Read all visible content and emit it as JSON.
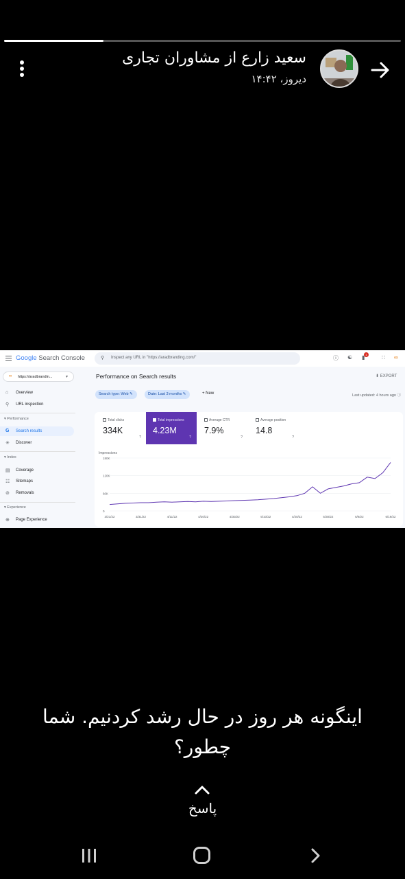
{
  "story": {
    "progress": 0.25
  },
  "header": {
    "title": "سعید زارع از مشاوران تجاری",
    "timestamp": "دیروز، ۱۴:۴۲",
    "back_icon": "arrow-right-icon",
    "menu_icon": "more-vert-icon"
  },
  "screenshot": {
    "logo_google": "Google",
    "logo_product": "Search Console",
    "search_placeholder": "Inspect any URL in \"https://aradbranding.com/\"",
    "property": "https://aradbrandin...",
    "nav": {
      "overview": "Overview",
      "url_inspection": "URL inspection",
      "section_performance": "Performance",
      "search_results": "Search results",
      "discover": "Discover",
      "section_index": "Index",
      "coverage": "Coverage",
      "sitemaps": "Sitemaps",
      "removals": "Removals",
      "section_experience": "Experience",
      "page_experience": "Page Experience"
    },
    "page_title": "Performance on Search results",
    "export": "EXPORT",
    "filter_type": "Search type: Web",
    "filter_date": "Date: Last 3 months",
    "new_label": "New",
    "last_updated": "Last updated: 4 hours ago",
    "notification_count": "1",
    "metrics": [
      {
        "label": "Total clicks",
        "value": "334K",
        "selected": false
      },
      {
        "label": "Total impressions",
        "value": "4.23M",
        "selected": true
      },
      {
        "label": "Average CTR",
        "value": "7.9%",
        "selected": false
      },
      {
        "label": "Average position",
        "value": "14.8",
        "selected": false
      }
    ],
    "accent_color": "#5e35b1"
  },
  "chart_data": {
    "type": "line",
    "ylabel": "Impressions",
    "y_ticks": [
      "180K",
      "120K",
      "60K",
      "0"
    ],
    "ylim": [
      0,
      180000
    ],
    "x_ticks": [
      "3/21/22",
      "3/31/22",
      "4/11/22",
      "4/20/22",
      "4/30/22",
      "5/10/22",
      "4/20/22",
      "5/30/22",
      "6/9/22",
      "6/19/22"
    ],
    "series": [
      {
        "color": "#5e35b1",
        "values": [
          22000,
          24000,
          26000,
          27000,
          28000,
          28000,
          30000,
          31000,
          30000,
          31000,
          32000,
          31000,
          33000,
          32000,
          33000,
          34000,
          35000,
          36000,
          37000,
          38000,
          40000,
          42000,
          45000,
          48000,
          52000,
          60000,
          82000,
          60000,
          75000,
          80000,
          85000,
          92000,
          96000,
          115000,
          110000,
          130000,
          165000
        ]
      }
    ],
    "grid": true
  },
  "caption": "اینگونه هر روز در حال رشد کردنیم. شما چطور؟",
  "reply_label": "پاسخ",
  "system_nav": {
    "recents": "recents-icon",
    "home": "home-icon",
    "back": "back-icon"
  }
}
